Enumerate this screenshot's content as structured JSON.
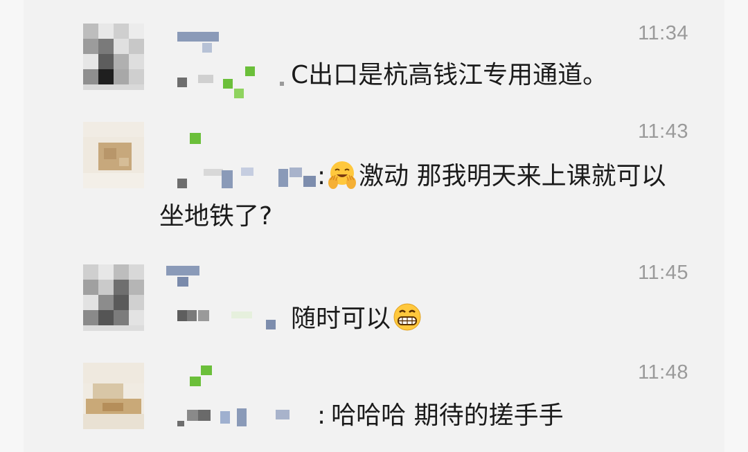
{
  "messages": [
    {
      "time": "11:34",
      "text": "C出口是杭高钱江专用通道。"
    },
    {
      "time": "11:43",
      "separator": ":",
      "emoji": "smiling-face-with-open-hands-emoji",
      "text_line1": "激动 那我明天来上课就可以",
      "text_line2": "坐地铁了?"
    },
    {
      "time": "11:45",
      "text": "随时可以",
      "emoji": "grinning-face-emoji"
    },
    {
      "time": "11:48",
      "separator": ":",
      "text": "哈哈哈 期待的搓手手"
    }
  ],
  "colors": {
    "background": "#f2f2f2",
    "time_text": "#9a9a9a",
    "message_text": "#1b1b1b",
    "pixel_green": "#6bbf3a",
    "pixel_blue": "#8a9ab8"
  }
}
